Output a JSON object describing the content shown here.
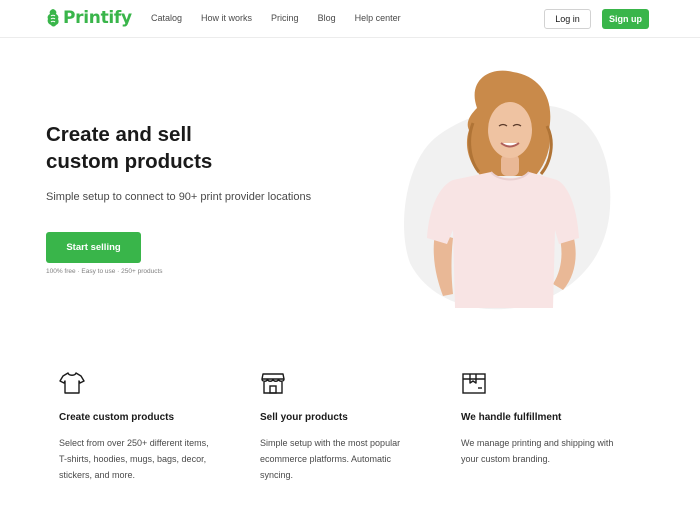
{
  "header": {
    "logo_text": "Printify",
    "nav": [
      "Catalog",
      "How it works",
      "Pricing",
      "Blog",
      "Help center"
    ],
    "login_label": "Log in",
    "signup_label": "Sign up"
  },
  "hero": {
    "title_lines": [
      "Create and sell",
      "custom products"
    ],
    "subtitle": "Simple setup to connect to 90+ print provider locations",
    "cta_label": "Start selling",
    "note": "100% free · Easy to use · 250+ products"
  },
  "features": [
    {
      "icon": "t-shirt-icon",
      "title": "Create custom products",
      "desc_lines": [
        "Select from over 250+ different items,",
        "T-shirts, hoodies, mugs, bags, decor,",
        "stickers, and more."
      ]
    },
    {
      "icon": "storefront-icon",
      "title": "Sell your products",
      "desc_lines": [
        "Simple setup with the most popular",
        "ecommerce platforms. Automatic",
        "syncing."
      ]
    },
    {
      "icon": "fulfillment-box-icon",
      "title": "We handle fulfillment",
      "desc_lines": [
        "We manage printing and shipping with",
        "your custom branding."
      ]
    }
  ],
  "colors": {
    "brand_green": "#39b54a",
    "text_dark": "#1a1a1a",
    "text_muted": "#4a4a4a"
  }
}
